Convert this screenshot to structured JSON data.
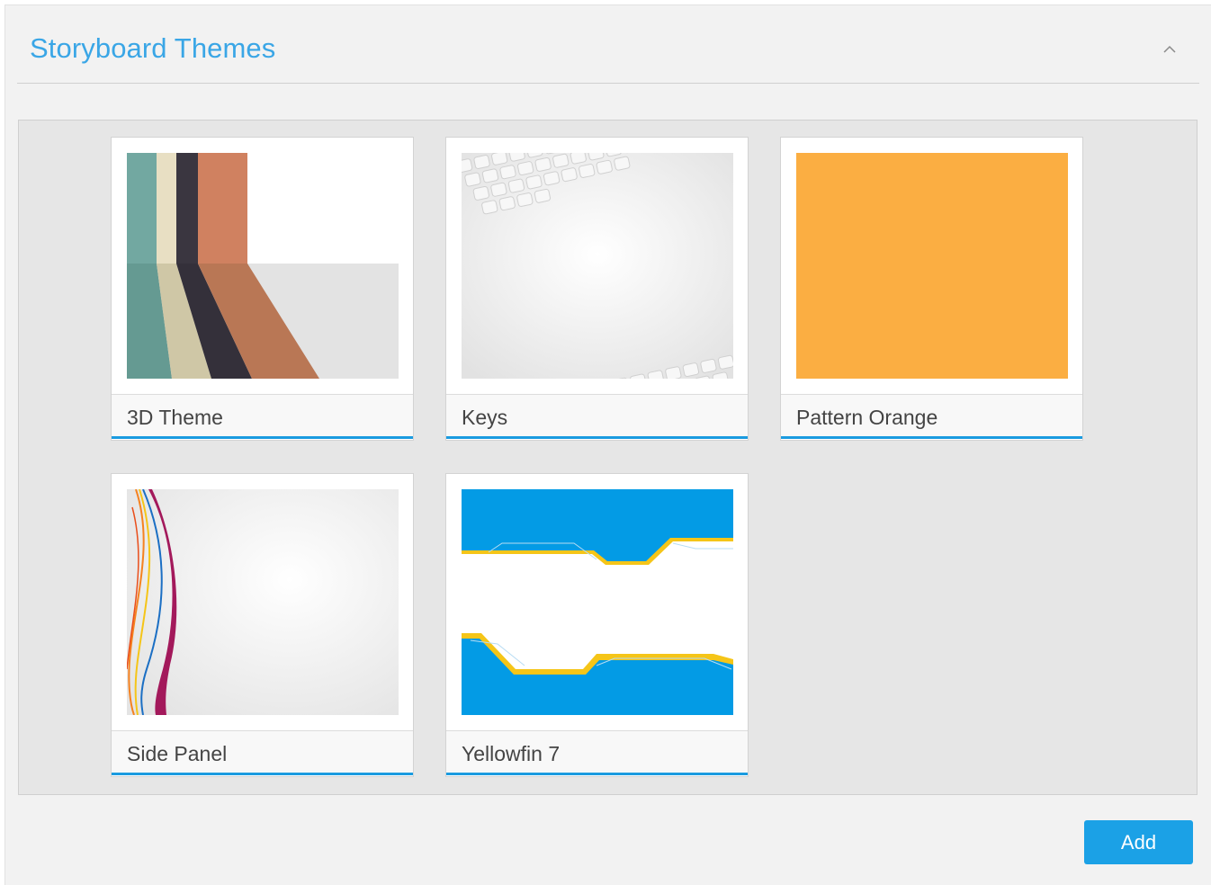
{
  "panel": {
    "title": "Storyboard Themes",
    "collapse_icon": "chevron-up-icon"
  },
  "themes": [
    {
      "label": "3D Theme"
    },
    {
      "label": "Keys"
    },
    {
      "label": "Pattern Orange"
    },
    {
      "label": "Side Panel"
    },
    {
      "label": "Yellowfin 7"
    }
  ],
  "actions": {
    "add_label": "Add"
  },
  "colors": {
    "accent": "#1ba1e6",
    "title": "#3aa6e6",
    "orange": "#fbae42",
    "yellowfin_blue": "#039be5",
    "yellowfin_yellow": "#f5c518"
  }
}
